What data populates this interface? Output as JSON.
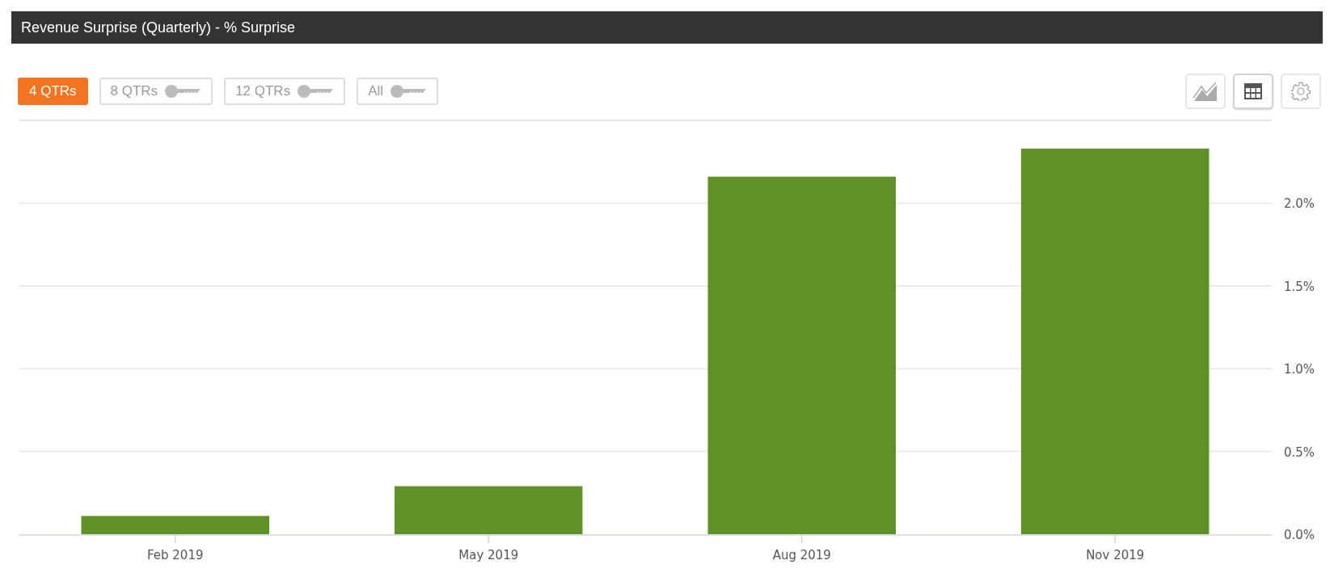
{
  "panel": {
    "title": "Revenue Surprise (Quarterly) - % Surprise"
  },
  "range_buttons": [
    {
      "label": "4 QTRs",
      "selected": true,
      "locked": false
    },
    {
      "label": "8 QTRs",
      "selected": false,
      "locked": true
    },
    {
      "label": "12 QTRs",
      "selected": false,
      "locked": true
    },
    {
      "label": "All",
      "selected": false,
      "locked": true
    }
  ],
  "view_buttons": [
    {
      "kind": "chart",
      "selected": false
    },
    {
      "kind": "table",
      "selected": true
    },
    {
      "kind": "settings",
      "selected": false
    }
  ],
  "chart": {
    "chart_data": {
      "type": "bar",
      "categories": [
        "Feb 2019",
        "May 2019",
        "Aug 2019",
        "Nov 2019"
      ],
      "series": [
        {
          "color": "#5f9126",
          "values": [
            0.11,
            0.29,
            2.16,
            2.33
          ]
        }
      ],
      "grid": true,
      "ylim": [
        0,
        2.5
      ],
      "yticks": [
        {
          "value": 0,
          "label": "0.0%"
        },
        {
          "value": 0.5,
          "label": "0.5%"
        },
        {
          "value": 1,
          "label": "1.0%"
        },
        {
          "value": 1.5,
          "label": "1.5%"
        },
        {
          "value": 2,
          "label": "2.0%"
        }
      ]
    }
  }
}
